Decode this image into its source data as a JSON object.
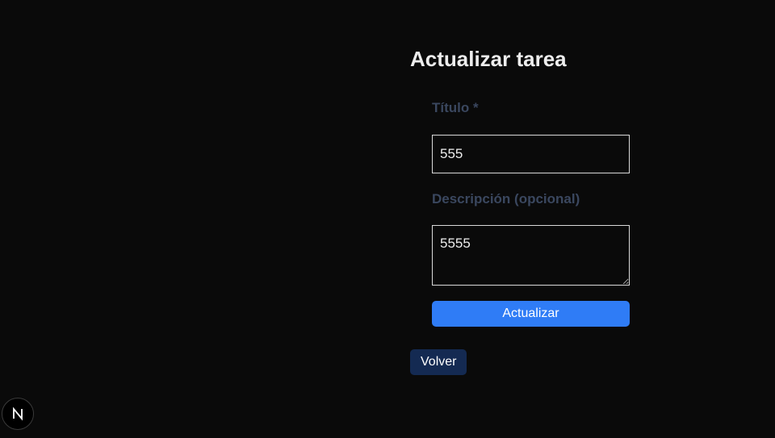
{
  "page": {
    "title": "Actualizar tarea"
  },
  "form": {
    "title_label": "Título *",
    "title_value": "555",
    "description_label": "Descripción (opcional)",
    "description_value": "5555",
    "submit_label": "Actualizar"
  },
  "nav": {
    "back_label": "Volver"
  },
  "dev_indicator": {
    "icon": "nextjs-logo-icon",
    "letter": "N"
  },
  "colors": {
    "background": "#0a0a0a",
    "label": "#3a475f",
    "primary_button": "#2f7cf6",
    "back_button": "#142a52"
  }
}
